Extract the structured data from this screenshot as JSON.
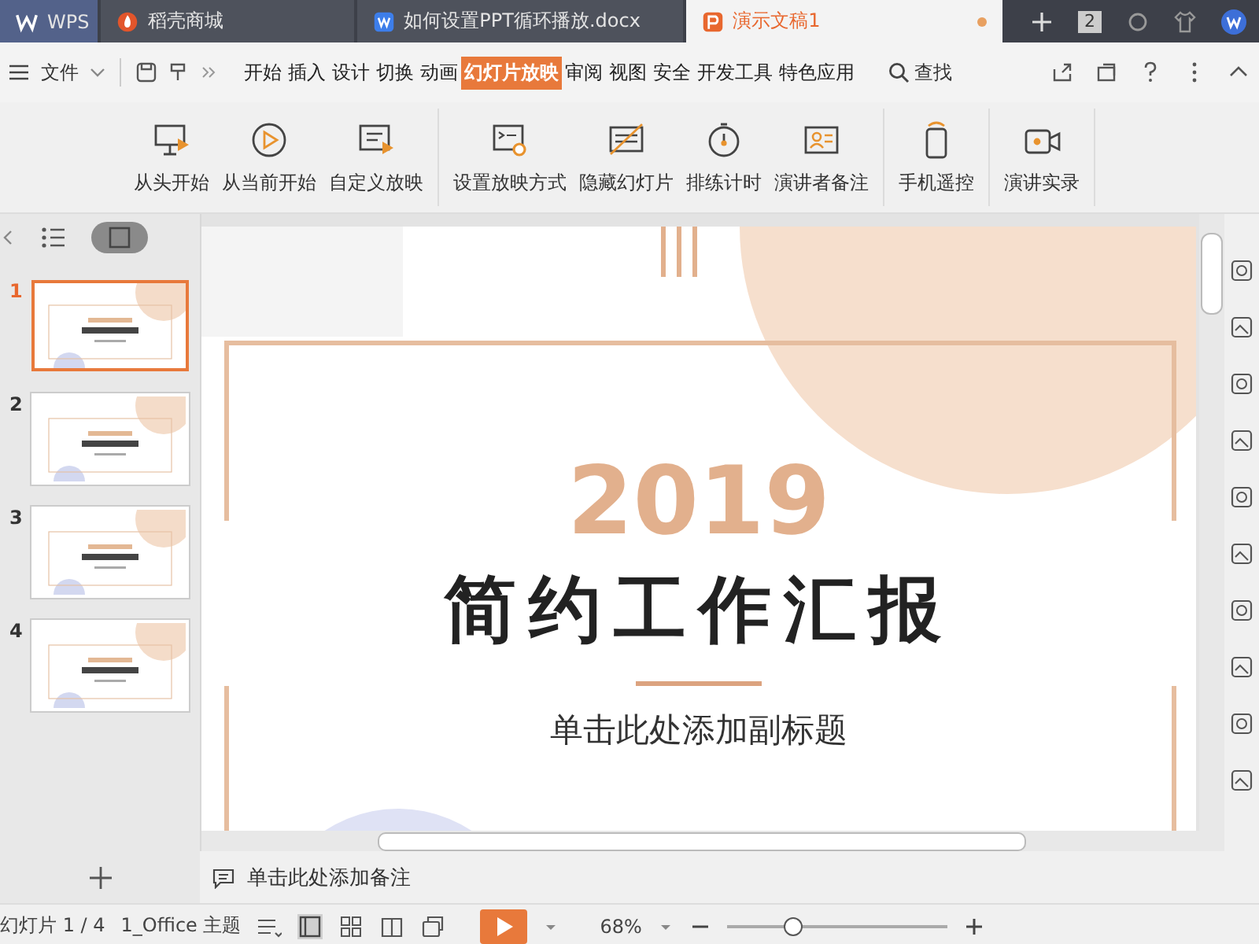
{
  "tabs": [
    {
      "label": "WPS",
      "kind": "home",
      "selected": false
    },
    {
      "label": "稻壳商城",
      "kind": "store",
      "selected": false
    },
    {
      "label": "如何设置PPT循环播放.docx",
      "kind": "doc",
      "selected": false
    },
    {
      "label": "演示文稿1",
      "kind": "ppt",
      "selected": true
    }
  ],
  "tab_count": "2",
  "menu": {
    "file": "文件",
    "items": [
      {
        "label": "开始",
        "selected": false
      },
      {
        "label": "插入",
        "selected": false
      },
      {
        "label": "设计",
        "selected": false
      },
      {
        "label": "切换",
        "selected": false
      },
      {
        "label": "动画",
        "selected": false
      },
      {
        "label": "幻灯片放映",
        "selected": true
      },
      {
        "label": "审阅",
        "selected": false
      },
      {
        "label": "视图",
        "selected": false
      },
      {
        "label": "安全",
        "selected": false
      },
      {
        "label": "开发工具",
        "selected": false
      },
      {
        "label": "特色应用",
        "selected": false
      }
    ],
    "search": "查找"
  },
  "ribbon": [
    {
      "buttons": [
        {
          "label": "从头开始",
          "kind": "screen"
        },
        {
          "label": "从当前开始",
          "kind": "play"
        },
        {
          "label": "自定义放映",
          "kind": "custom"
        }
      ]
    },
    {
      "buttons": [
        {
          "label": "设置放映方式",
          "kind": "settings"
        },
        {
          "label": "隐藏幻灯片",
          "kind": "hide"
        },
        {
          "label": "排练计时",
          "kind": "timer"
        },
        {
          "label": "演讲者备注",
          "kind": "presenter"
        }
      ]
    },
    {
      "buttons": [
        {
          "label": "手机遥控",
          "kind": "phone"
        }
      ]
    },
    {
      "buttons": [
        {
          "label": "演讲实录",
          "kind": "record"
        }
      ]
    }
  ],
  "panel_views": [
    {
      "kind": "outline",
      "selected": false
    },
    {
      "kind": "thumbnails",
      "selected": true
    }
  ],
  "slides": [
    {
      "number": "1",
      "selected": true
    },
    {
      "number": "2",
      "selected": false
    },
    {
      "number": "3",
      "selected": false
    },
    {
      "number": "4",
      "selected": false
    }
  ],
  "slide": {
    "year": "2019",
    "title": "简约工作汇报",
    "subtitle": "单击此处添加副标题"
  },
  "notes": {
    "placeholder": "单击此处添加备注"
  },
  "status_bar": {
    "slide_counter": "幻灯片 1 / 4",
    "theme": "1_Office 主题",
    "zoom": "68%",
    "zoom_slider": {
      "level": 0.3
    }
  }
}
